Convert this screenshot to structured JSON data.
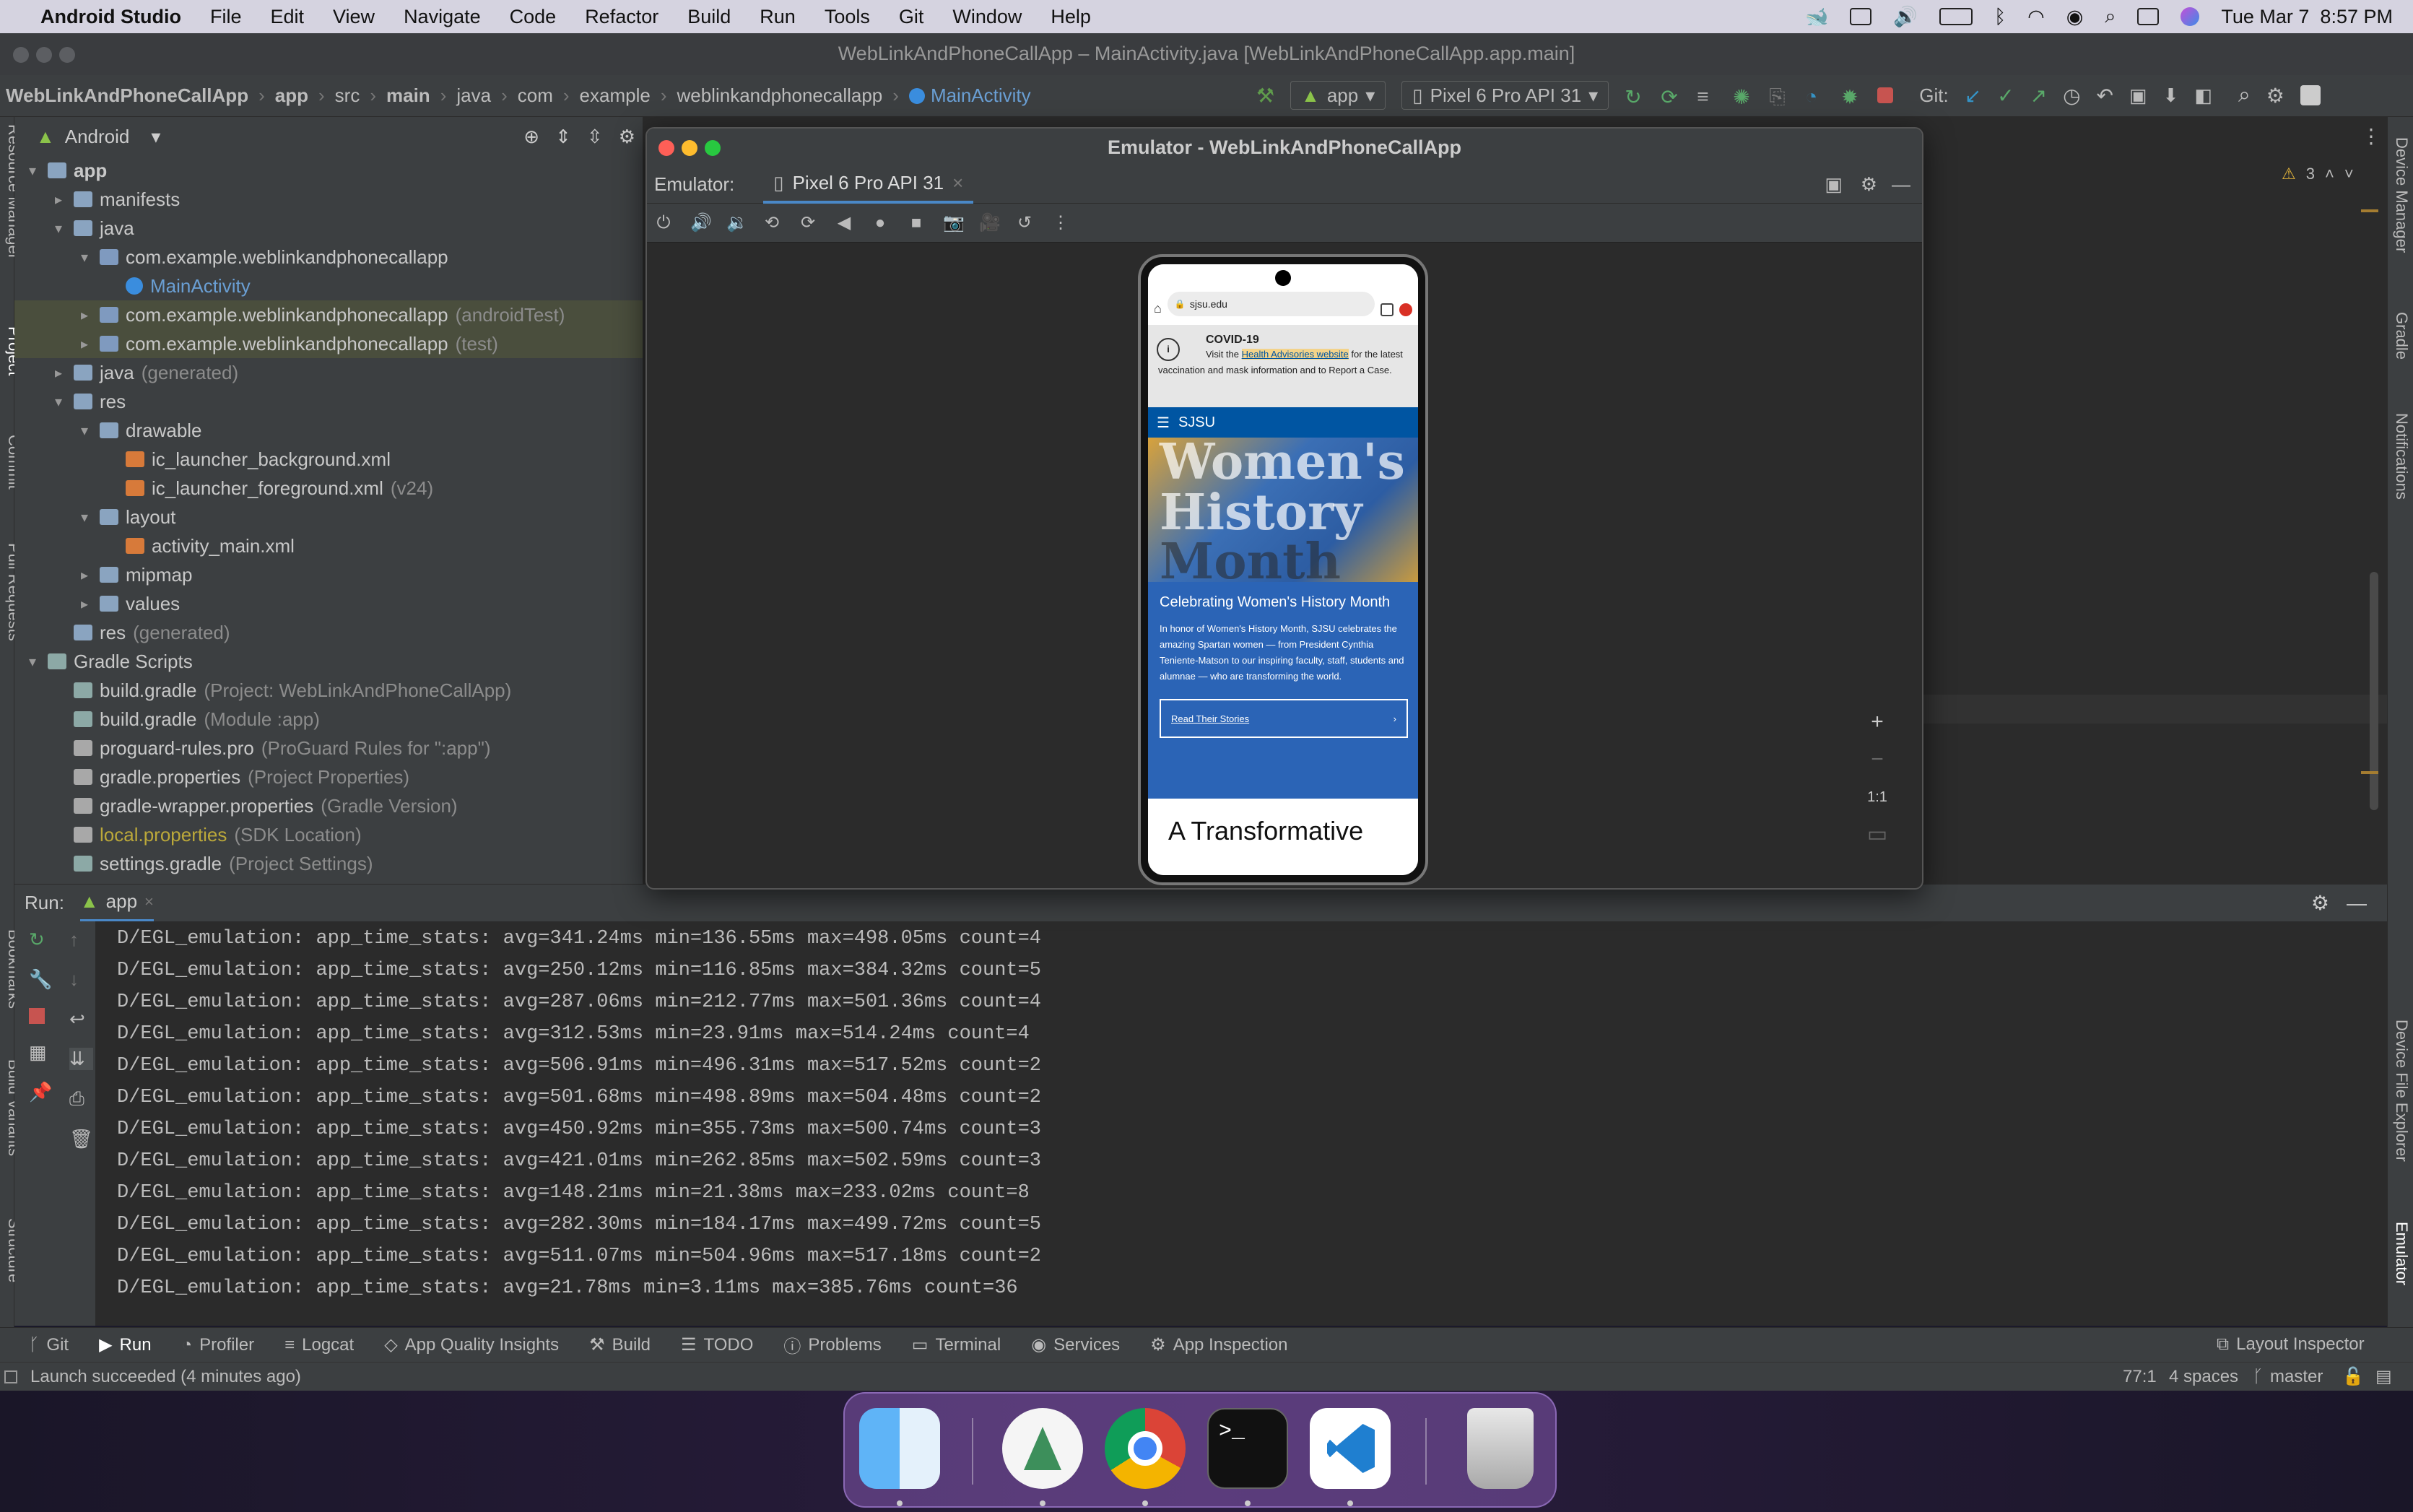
{
  "menubar": {
    "app_name": "Android Studio",
    "items": [
      "File",
      "Edit",
      "View",
      "Navigate",
      "Code",
      "Refactor",
      "Build",
      "Run",
      "Tools",
      "Git",
      "Window",
      "Help"
    ],
    "datetime": "Tue Mar 7  8:57 PM"
  },
  "window_title": "WebLinkAndPhoneCallApp – MainActivity.java [WebLinkAndPhoneCallApp.app.main]",
  "breadcrumb": [
    "WebLinkAndPhoneCallApp",
    "app",
    "src",
    "main",
    "java",
    "com",
    "example",
    "weblinkandphonecallapp",
    "MainActivity"
  ],
  "toolbar": {
    "run_config": "app",
    "device": "Pixel 6 Pro API 31",
    "git_label": "Git:"
  },
  "project_panel": {
    "view_mode": "Android",
    "tree": [
      {
        "level": 0,
        "chevron": "▾",
        "icon": "folder",
        "label": "app",
        "hint": "",
        "bold": true
      },
      {
        "level": 1,
        "chevron": "▸",
        "icon": "folder",
        "label": "manifests",
        "hint": ""
      },
      {
        "level": 1,
        "chevron": "▾",
        "icon": "folder",
        "label": "java",
        "hint": ""
      },
      {
        "level": 2,
        "chevron": "▾",
        "icon": "pkg",
        "label": "com.example.weblinkandphonecallapp",
        "hint": ""
      },
      {
        "level": 3,
        "chevron": "",
        "icon": "cls",
        "label": "MainActivity",
        "hint": "",
        "link": true
      },
      {
        "level": 2,
        "chevron": "▸",
        "icon": "pkg",
        "label": "com.example.weblinkandphonecallapp",
        "hint": "(androidTest)",
        "selected": true
      },
      {
        "level": 2,
        "chevron": "▸",
        "icon": "pkg",
        "label": "com.example.weblinkandphonecallapp",
        "hint": "(test)",
        "selected": true
      },
      {
        "level": 1,
        "chevron": "▸",
        "icon": "folder",
        "label": "java",
        "hint": "(generated)"
      },
      {
        "level": 1,
        "chevron": "▾",
        "icon": "folder",
        "label": "res",
        "hint": ""
      },
      {
        "level": 2,
        "chevron": "▾",
        "icon": "folder",
        "label": "drawable",
        "hint": ""
      },
      {
        "level": 3,
        "chevron": "",
        "icon": "xml",
        "label": "ic_launcher_background.xml",
        "hint": ""
      },
      {
        "level": 3,
        "chevron": "",
        "icon": "xml",
        "label": "ic_launcher_foreground.xml",
        "hint": "(v24)"
      },
      {
        "level": 2,
        "chevron": "▾",
        "icon": "folder",
        "label": "layout",
        "hint": ""
      },
      {
        "level": 3,
        "chevron": "",
        "icon": "xml",
        "label": "activity_main.xml",
        "hint": ""
      },
      {
        "level": 2,
        "chevron": "▸",
        "icon": "folder",
        "label": "mipmap",
        "hint": ""
      },
      {
        "level": 2,
        "chevron": "▸",
        "icon": "folder",
        "label": "values",
        "hint": ""
      },
      {
        "level": 1,
        "chevron": "",
        "icon": "folder",
        "label": "res",
        "hint": "(generated)"
      },
      {
        "level": 0,
        "chevron": "▾",
        "icon": "grad",
        "label": "Gradle Scripts",
        "hint": ""
      },
      {
        "level": 1,
        "chevron": "",
        "icon": "grad",
        "label": "build.gradle",
        "hint": "(Project: WebLinkAndPhoneCallApp)"
      },
      {
        "level": 1,
        "chevron": "",
        "icon": "grad",
        "label": "build.gradle",
        "hint": "(Module :app)"
      },
      {
        "level": 1,
        "chevron": "",
        "icon": "prop",
        "label": "proguard-rules.pro",
        "hint": "(ProGuard Rules for \":app\")"
      },
      {
        "level": 1,
        "chevron": "",
        "icon": "prop",
        "label": "gradle.properties",
        "hint": "(Project Properties)"
      },
      {
        "level": 1,
        "chevron": "",
        "icon": "prop",
        "label": "gradle-wrapper.properties",
        "hint": "(Gradle Version)"
      },
      {
        "level": 1,
        "chevron": "",
        "icon": "prop",
        "label": "local.properties",
        "hint": "(SDK Location)",
        "yellow": true
      },
      {
        "level": 1,
        "chevron": "",
        "icon": "grad",
        "label": "settings.gradle",
        "hint": "(Project Settings)"
      }
    ]
  },
  "left_strip_labels": [
    "Resource Manager",
    "Project",
    "Commit",
    "Pull Requests",
    "Bookmarks",
    "Build Variants",
    "Structure"
  ],
  "right_strip_labels": [
    "Device Manager",
    "Gradle",
    "Notifications",
    "Device File Explorer",
    "Emulator"
  ],
  "editor": {
    "warnings": "3"
  },
  "emulator": {
    "title": "Emulator - WebLinkAndPhoneCallApp",
    "label": "Emulator:",
    "tab": "Pixel 6 Pro API 31",
    "zoom_one_to_one": "1:1",
    "phone": {
      "url": "sjsu.edu",
      "covid_title": "COVID-19",
      "covid_text_a": "Visit the ",
      "covid_link": "Health Advisories website",
      "covid_text_b": " for the latest vaccination and mask information and to Report a Case.",
      "brand": "SJSU",
      "hero_words": [
        "Women's",
        "History",
        "Month"
      ],
      "heading": "Celebrating Women's History Month",
      "body": "In honor of Women's History Month, SJSU celebrates the amazing Spartan women — from President Cynthia Teniente-Matson to our inspiring faculty, staff, students and alumnae — who are transforming the world.",
      "cta": "Read Their Stories",
      "next_heading": "A Transformative"
    }
  },
  "run_panel": {
    "label": "Run:",
    "tab": "app",
    "lines": [
      "D/EGL_emulation: app_time_stats: avg=341.24ms min=136.55ms max=498.05ms count=4",
      "D/EGL_emulation: app_time_stats: avg=250.12ms min=116.85ms max=384.32ms count=5",
      "D/EGL_emulation: app_time_stats: avg=287.06ms min=212.77ms max=501.36ms count=4",
      "D/EGL_emulation: app_time_stats: avg=312.53ms min=23.91ms max=514.24ms count=4",
      "D/EGL_emulation: app_time_stats: avg=506.91ms min=496.31ms max=517.52ms count=2",
      "D/EGL_emulation: app_time_stats: avg=501.68ms min=498.89ms max=504.48ms count=2",
      "D/EGL_emulation: app_time_stats: avg=450.92ms min=355.73ms max=500.74ms count=3",
      "D/EGL_emulation: app_time_stats: avg=421.01ms min=262.85ms max=502.59ms count=3",
      "D/EGL_emulation: app_time_stats: avg=148.21ms min=21.38ms max=233.02ms count=8",
      "D/EGL_emulation: app_time_stats: avg=282.30ms min=184.17ms max=499.72ms count=5",
      "D/EGL_emulation: app_time_stats: avg=511.07ms min=504.96ms max=517.18ms count=2",
      "D/EGL_emulation: app_time_stats: avg=21.78ms min=3.11ms max=385.76ms count=36"
    ]
  },
  "bottom_tools": [
    {
      "label": "Git",
      "icon": "git-icon"
    },
    {
      "label": "Run",
      "icon": "play-icon",
      "active": true
    },
    {
      "label": "Profiler",
      "icon": "profiler-icon"
    },
    {
      "label": "Logcat",
      "icon": "logcat-icon"
    },
    {
      "label": "App Quality Insights",
      "icon": "insights-icon"
    },
    {
      "label": "Build",
      "icon": "hammer-icon"
    },
    {
      "label": "TODO",
      "icon": "list-icon"
    },
    {
      "label": "Problems",
      "icon": "info-icon"
    },
    {
      "label": "Terminal",
      "icon": "terminal-icon"
    },
    {
      "label": "Services",
      "icon": "services-icon"
    },
    {
      "label": "App Inspection",
      "icon": "inspection-icon"
    }
  ],
  "layout_inspector": "Layout Inspector",
  "status": {
    "message": "Launch succeeded (4 minutes ago)",
    "position": "77:1",
    "indent": "4 spaces",
    "branch": "master"
  },
  "dock": [
    "finder-icon",
    "android-studio-icon",
    "chrome-icon",
    "terminal-icon",
    "vscode-icon",
    "trash-icon"
  ],
  "colors": {
    "accent": "#3592c4",
    "sjsu_blue": "#0055a2",
    "sjsu_gold": "#e5a823"
  }
}
